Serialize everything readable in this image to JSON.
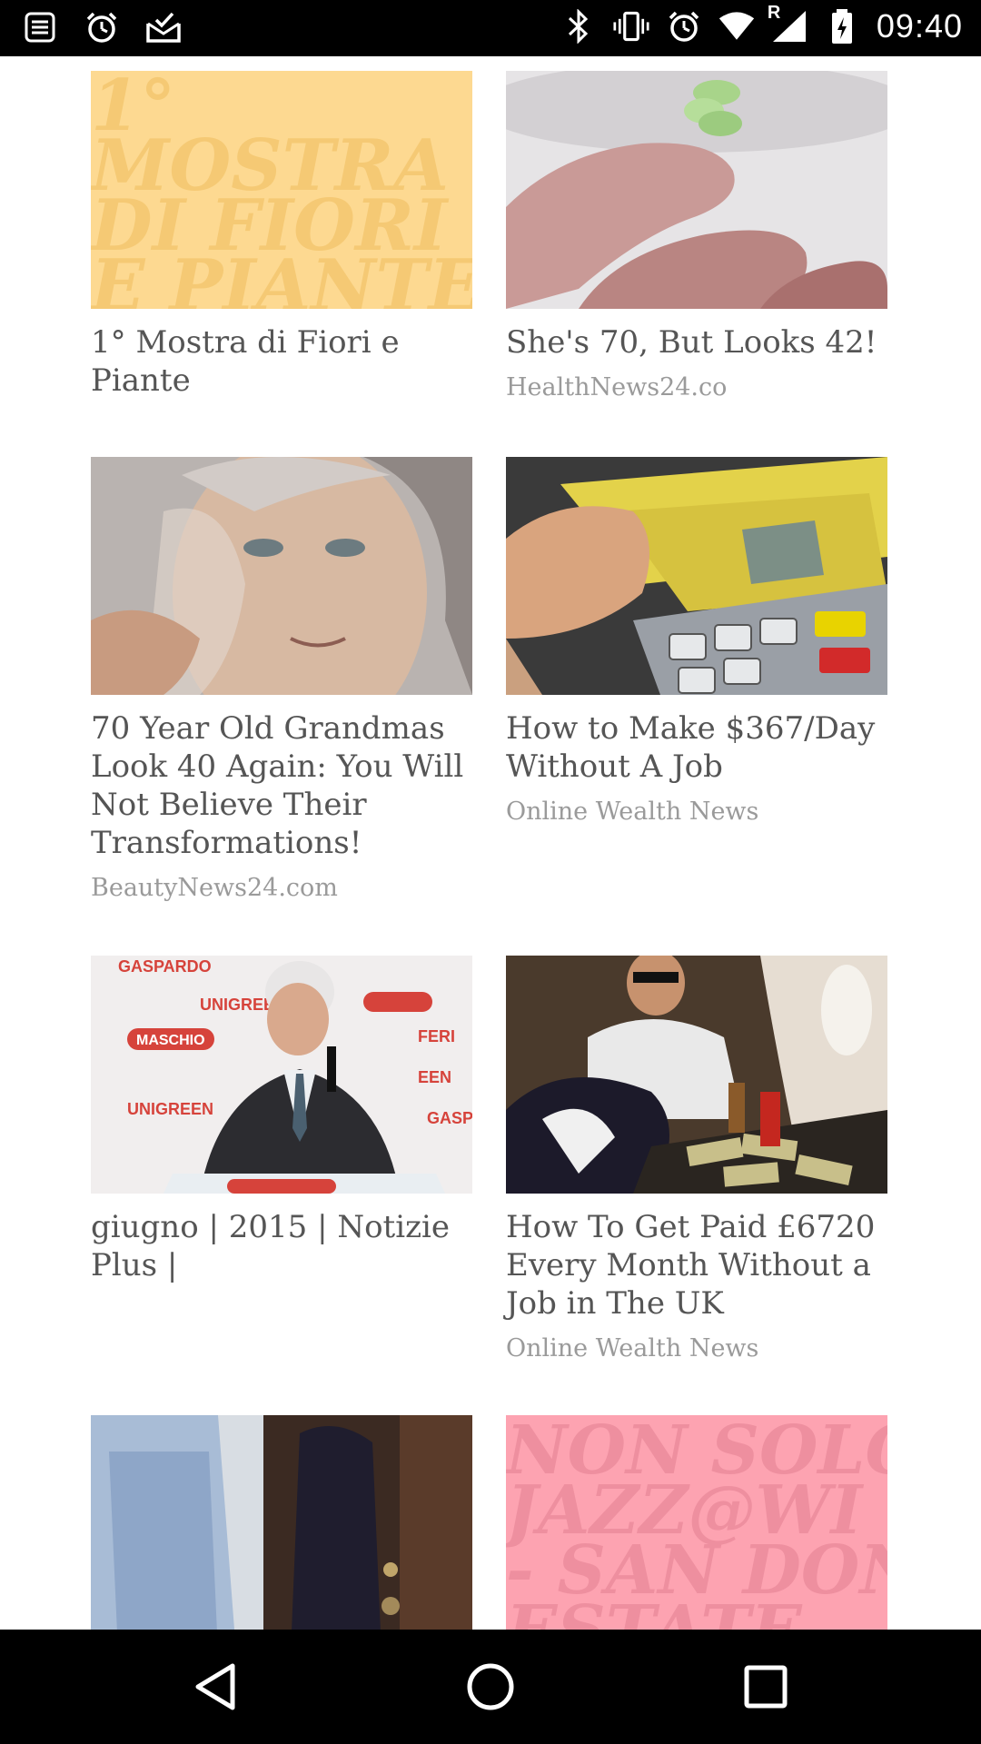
{
  "status_bar": {
    "time": "09:40",
    "left_icons": [
      "notes-icon",
      "alarm-icon",
      "mail-check-icon"
    ],
    "right_icons": [
      "bluetooth-icon",
      "vibrate-icon",
      "alarm-icon",
      "wifi-icon",
      "signal-icon",
      "battery-icon"
    ],
    "roaming_label": "R"
  },
  "feed": {
    "cards": [
      {
        "tile_text": [
          "1°",
          "MOSTRA",
          "DI FIORI",
          "E PIANTE"
        ],
        "tile_color": "#fdd991",
        "tile_text_color": "#f5c974",
        "title": "1° Mostra di Fiori e Piante",
        "source": ""
      },
      {
        "image_desc": "finger-with-green-cream",
        "title": "She's 70, But Looks 42!",
        "source": "HealthNews24.co"
      },
      {
        "image_desc": "woman-peeling-mask",
        "title": "70 Year Old Grandmas Look 40 Again: You Will Not Believe Their Transformations!",
        "source": "BeautyNews24.com"
      },
      {
        "image_desc": "hand-with-money-at-atm",
        "title": "How to Make $367/Day Without A Job",
        "source": "Online Wealth News"
      },
      {
        "image_desc": "speaker-at-podium",
        "banner_words": [
          "GASPARDO",
          "UNIGREEN",
          "MASCHIO",
          "FERI",
          "EEN",
          "GASP"
        ],
        "title": "giugno | 2015 | Notizie Plus |",
        "source": ""
      },
      {
        "image_desc": "man-on-jet-with-cash",
        "title": "How To Get Paid £6720 Every Month Without a Job in The UK",
        "source": "Online Wealth News"
      },
      {
        "image_desc": "men-at-doorway",
        "title": "",
        "source": ""
      },
      {
        "tile_text": [
          "NON SOLO",
          "JAZZ@WI",
          "- SAN DON",
          "ESTATE"
        ],
        "tile_color": "#fda3b1",
        "tile_text_color": "#ee8f9f",
        "title": "",
        "source": ""
      }
    ]
  },
  "nav_bar": {
    "icons": [
      "back-icon",
      "home-icon",
      "recents-icon"
    ]
  },
  "colors": {
    "title": "#555555",
    "source": "#9a9a9a",
    "bars": "#000000"
  }
}
